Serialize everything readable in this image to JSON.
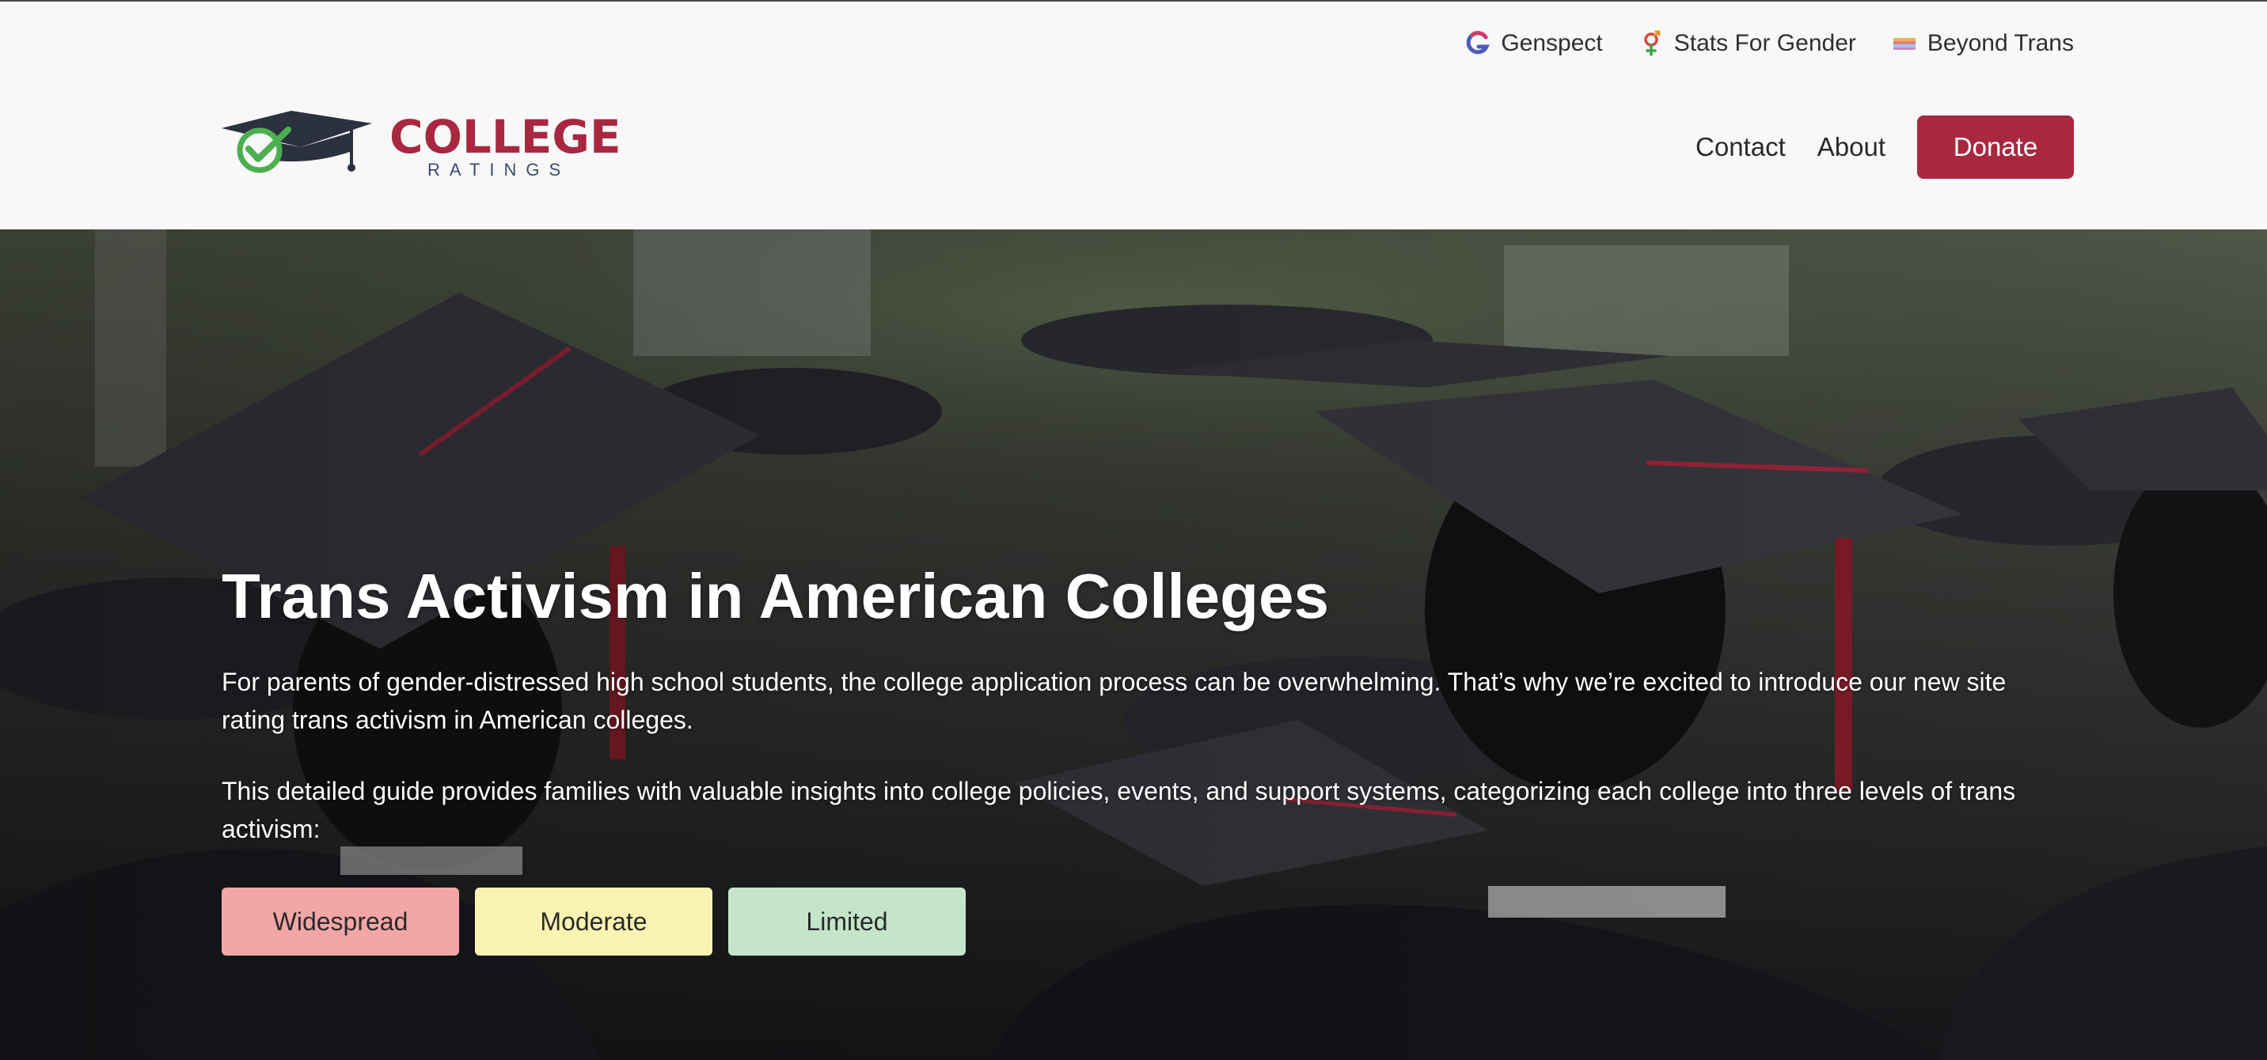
{
  "header": {
    "partner_links": [
      {
        "label": "Genspect",
        "icon": "genspect-logo-icon"
      },
      {
        "label": "Stats For Gender",
        "icon": "stats-for-gender-logo-icon"
      },
      {
        "label": "Beyond Trans",
        "icon": "beyond-trans-logo-icon"
      }
    ],
    "logo": {
      "title": "COLLEGE",
      "subtitle": "RATINGS",
      "icon": "graduation-cap-check-icon"
    },
    "nav": {
      "contact_label": "Contact",
      "about_label": "About",
      "donate_label": "Donate"
    }
  },
  "hero": {
    "title": "Trans Activism in American Colleges",
    "paragraph_1": "For parents of gender-distressed high school students, the college application process can be overwhelming. That’s why we’re excited to introduce our new site rating trans activism in American colleges.",
    "paragraph_2": "This detailed guide provides families with valuable insights into college policies, events, and support systems, categorizing each college into three levels of trans activism:",
    "levels": [
      {
        "label": "Widespread",
        "color": "#f2a6a6"
      },
      {
        "label": "Moderate",
        "color": "#fbf3b2"
      },
      {
        "label": "Limited",
        "color": "#c4e5ca"
      }
    ],
    "background": "graduation-caps-photo"
  },
  "colors": {
    "brand": "#a8283f",
    "brand_secondary": "#3b4a6e",
    "header_bg": "#f8f8f8"
  }
}
